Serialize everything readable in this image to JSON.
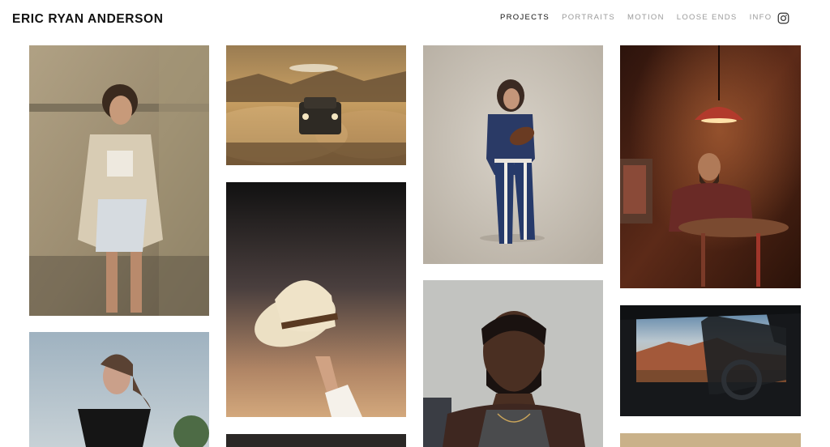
{
  "site": {
    "title": "ERIC RYAN ANDERSON"
  },
  "nav": {
    "items": [
      {
        "label": "PROJECTS",
        "active": true
      },
      {
        "label": "PORTRAITS",
        "active": false
      },
      {
        "label": "MOTION",
        "active": false
      },
      {
        "label": "LOOSE ENDS",
        "active": false
      },
      {
        "label": "INFO",
        "active": false
      }
    ],
    "social_icon": "instagram-icon"
  },
  "gallery": {
    "photos": [
      {
        "name": "photo-woman-leaning-wall",
        "column": 1,
        "subject": "woman in beige jacket leaning on stone wall"
      },
      {
        "name": "photo-woman-black-top",
        "column": 1,
        "subject": "woman in black top under sky"
      },
      {
        "name": "photo-truck-desert-dust",
        "column": 2,
        "subject": "pickup truck in desert dust"
      },
      {
        "name": "photo-hand-holding-cowboy-hat",
        "column": 2,
        "subject": "hand holding cowboy hat"
      },
      {
        "name": "photo-dark-partial",
        "column": 2,
        "subject": "dark image"
      },
      {
        "name": "photo-woman-football",
        "column": 3,
        "subject": "woman holding football"
      },
      {
        "name": "photo-man-portrait-closeup",
        "column": 3,
        "subject": "bearded man in tank top"
      },
      {
        "name": "photo-man-bar-table",
        "column": 4,
        "subject": "man seated at bar table under lamp"
      },
      {
        "name": "photo-canyon-through-car-window",
        "column": 4,
        "subject": "desert canyon through car window"
      },
      {
        "name": "photo-warm-partial",
        "column": 4,
        "subject": "warm tone image"
      }
    ]
  },
  "colors": {
    "active_nav": "#111111",
    "inactive_nav": "#9a9a9a",
    "background": "#ffffff"
  }
}
